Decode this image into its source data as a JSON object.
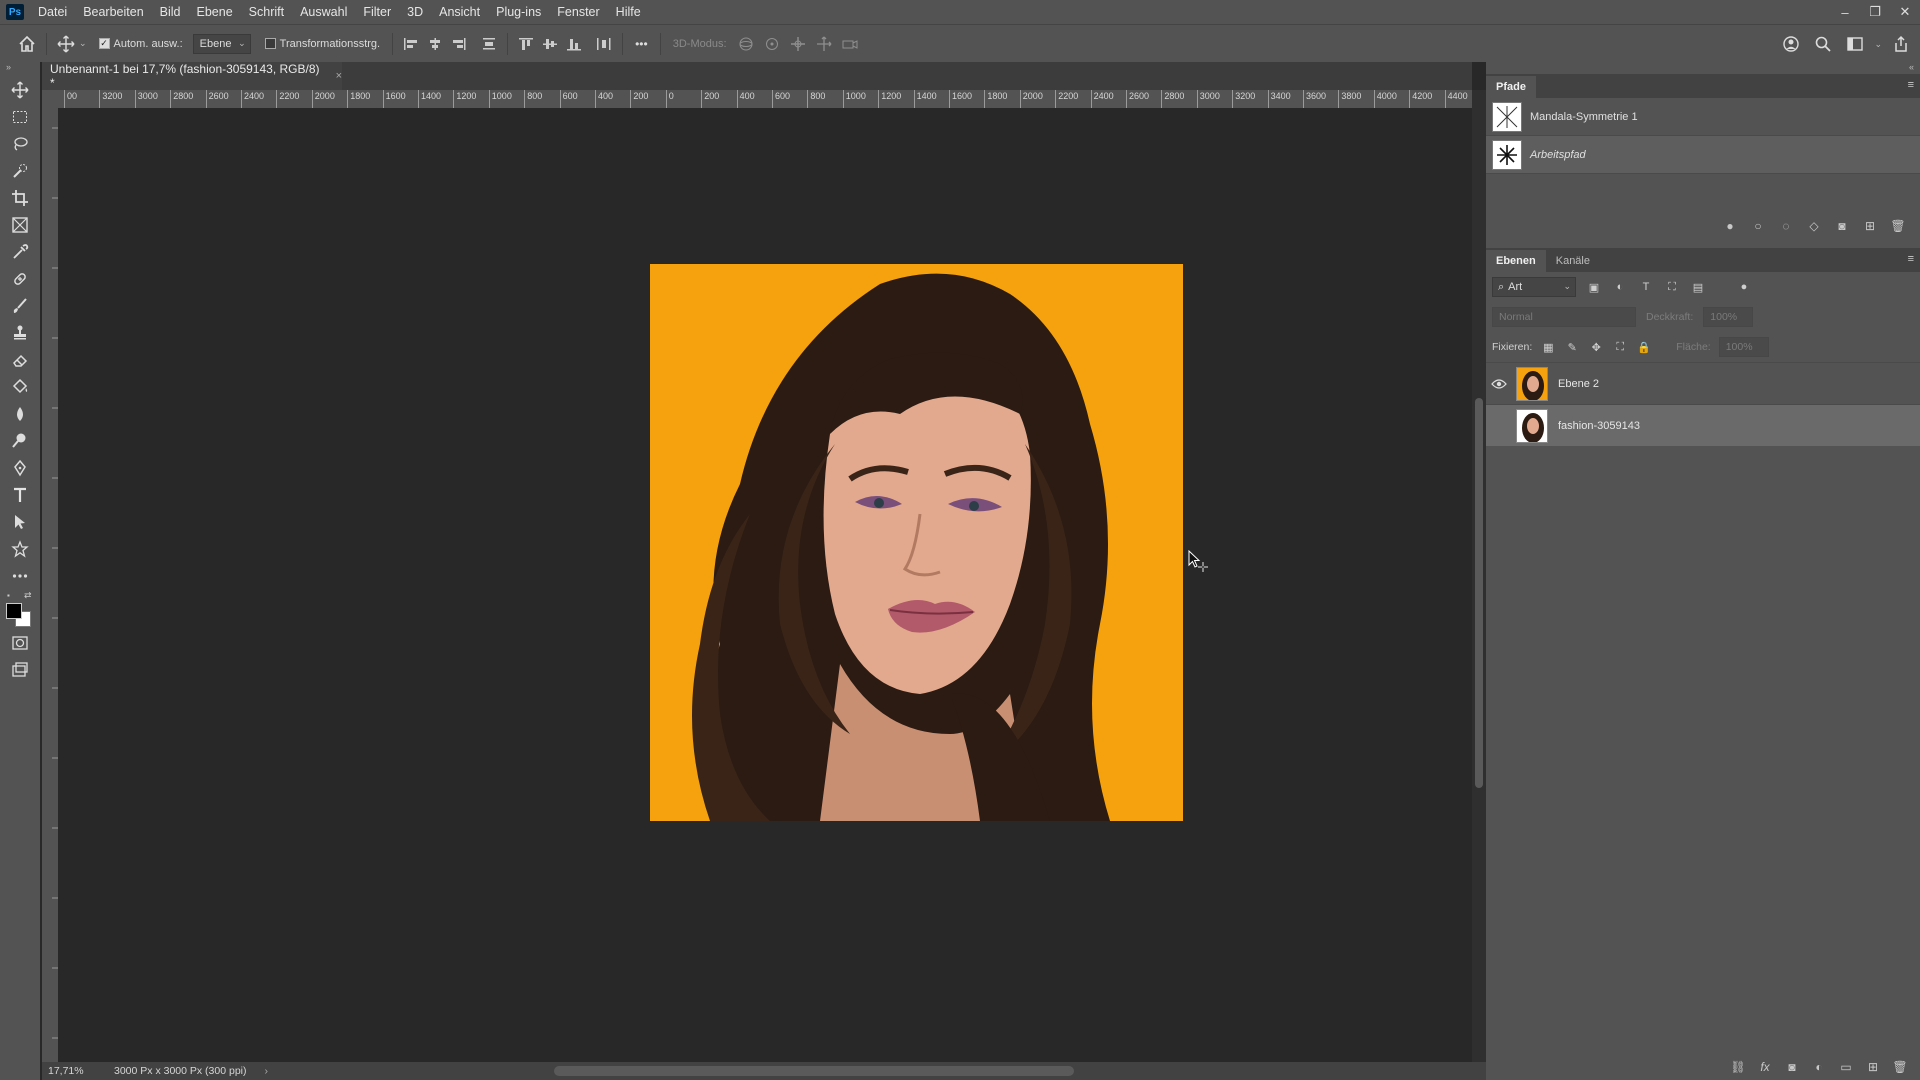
{
  "app": {
    "logo": "Ps"
  },
  "menu": [
    "Datei",
    "Bearbeiten",
    "Bild",
    "Ebene",
    "Schrift",
    "Auswahl",
    "Filter",
    "3D",
    "Ansicht",
    "Plug-ins",
    "Fenster",
    "Hilfe"
  ],
  "window_controls": {
    "minimize": "–",
    "restore": "❐",
    "close": "✕"
  },
  "options": {
    "auto_select_label": "Autom. ausw.:",
    "auto_select_checked": true,
    "auto_select_target": "Ebene",
    "transform_label": "Transformationsstrg.",
    "transform_checked": false,
    "more": "•••",
    "mode_3d_label": "3D-Modus:"
  },
  "document": {
    "tab_title": "Unbenannt-1 bei 17,7% (fashion-3059143, RGB/8) *",
    "close": "×"
  },
  "ruler": {
    "h_ticks": [
      "00",
      "3200",
      "3000",
      "2800",
      "2600",
      "2400",
      "2200",
      "2000",
      "1800",
      "1600",
      "1400",
      "1200",
      "1000",
      "800",
      "600",
      "400",
      "200",
      "0",
      "200",
      "400",
      "600",
      "800",
      "1000",
      "1200",
      "1400",
      "1600",
      "1800",
      "2000",
      "2200",
      "2400",
      "2600",
      "2800",
      "3000",
      "3200",
      "3400",
      "3600",
      "3800",
      "4000",
      "4200",
      "4400"
    ]
  },
  "status": {
    "zoom": "17,71%",
    "doc_size": "3000 Px x 3000 Px (300 ppi)",
    "arrow": "›"
  },
  "paths_panel": {
    "tab": "Pfade",
    "items": [
      {
        "name": "Mandala-Symmetrie 1",
        "italic": false
      },
      {
        "name": "Arbeitspfad",
        "italic": true
      }
    ]
  },
  "layers_panel": {
    "tabs": [
      "Ebenen",
      "Kanäle"
    ],
    "filter_kind": "Art",
    "blend_mode": "Normal",
    "opacity_label": "Deckkraft:",
    "opacity_value": "100%",
    "lock_label": "Fixieren:",
    "fill_label": "Fläche:",
    "fill_value": "100%",
    "layers": [
      {
        "name": "Ebene 2",
        "visible": true,
        "selected": false
      },
      {
        "name": "fashion-3059143",
        "visible": false,
        "selected": true
      }
    ]
  },
  "colors": {
    "canvas_bg": "#282828",
    "artboard_bg": "#f5a20e",
    "chrome": "#535353",
    "accent_blue": "#31a8ff"
  }
}
